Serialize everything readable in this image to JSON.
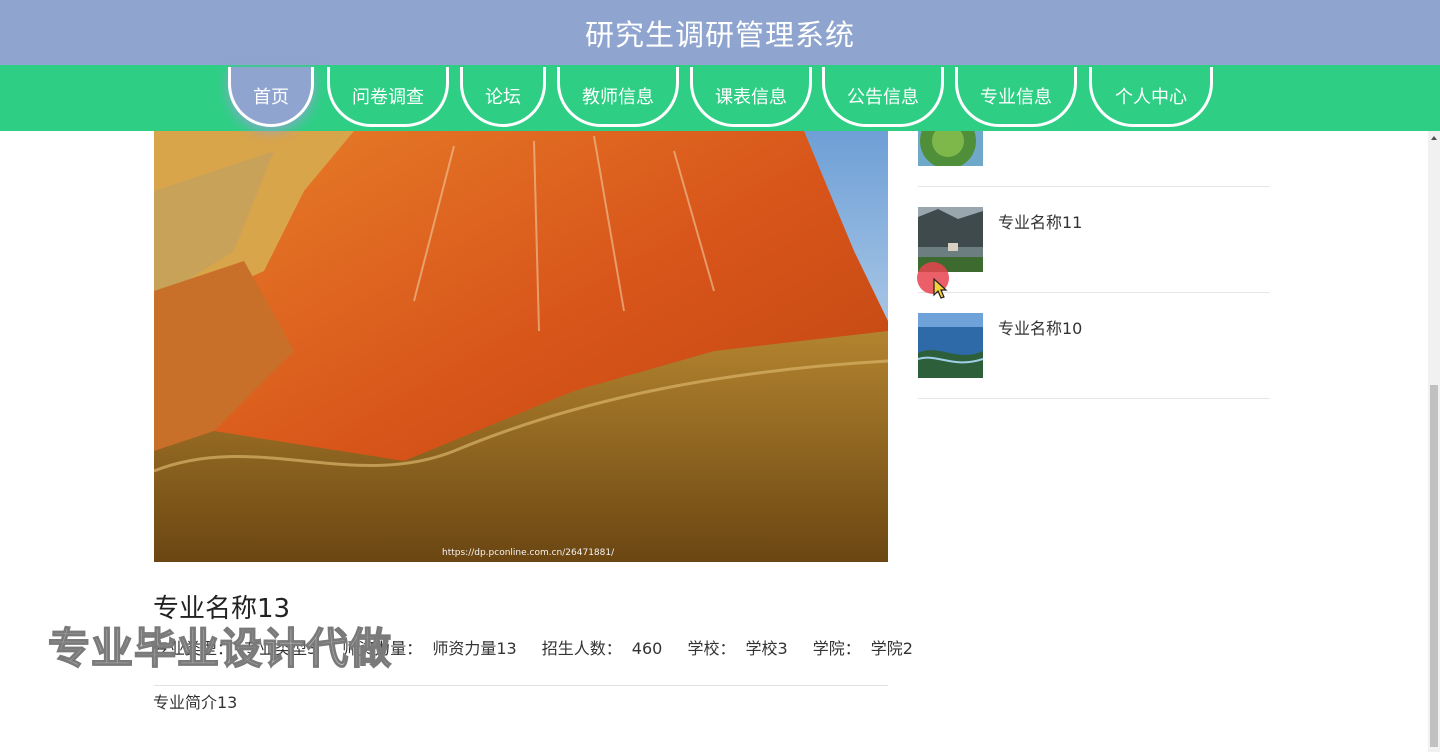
{
  "app": {
    "title": "研究生调研管理系统"
  },
  "nav": {
    "items": [
      {
        "label": "首页",
        "active": true
      },
      {
        "label": "问卷调查"
      },
      {
        "label": "论坛"
      },
      {
        "label": "教师信息"
      },
      {
        "label": "课表信息"
      },
      {
        "label": "公告信息"
      },
      {
        "label": "专业信息"
      },
      {
        "label": "个人中心"
      }
    ]
  },
  "detail": {
    "image_caption": "https://dp.pconline.com.cn/26471881/",
    "title": "专业名称13",
    "attributes": [
      {
        "label": "专业类型：",
        "value": "专业类型3"
      },
      {
        "label": "师资力量：",
        "value": "师资力量13"
      },
      {
        "label": "招生人数：",
        "value": "460"
      },
      {
        "label": "学校：",
        "value": "学校3"
      },
      {
        "label": "学院：",
        "value": "学院2"
      }
    ],
    "intro": "专业简介13"
  },
  "sidebar": {
    "items": [
      {
        "name": ""
      },
      {
        "name": "专业名称11"
      },
      {
        "name": "专业名称10"
      }
    ]
  },
  "overlay": {
    "watermark": "专业毕业设计代做"
  },
  "colors": {
    "title_bar": "#8fa5cf",
    "nav_bar": "#2ecf85",
    "nav_active": "#8fa5cf"
  }
}
